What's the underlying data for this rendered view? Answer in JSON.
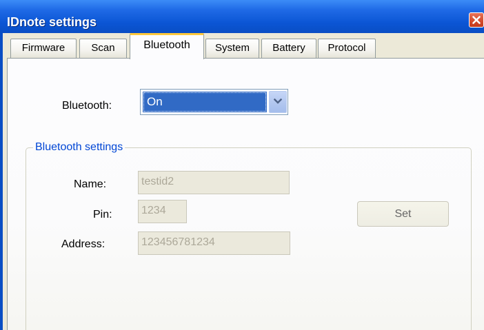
{
  "window": {
    "title": "IDnote settings"
  },
  "tabs": [
    {
      "label": "Firmware",
      "active": false
    },
    {
      "label": "Scan",
      "active": false
    },
    {
      "label": "Bluetooth",
      "active": true
    },
    {
      "label": "System",
      "active": false
    },
    {
      "label": "Battery",
      "active": false
    },
    {
      "label": "Protocol",
      "active": false
    }
  ],
  "bluetooth": {
    "label": "Bluetooth:",
    "selected_value": "On"
  },
  "settings_group": {
    "title": "Bluetooth settings",
    "name_label": "Name:",
    "name_value": "testid2",
    "pin_label": "Pin:",
    "pin_value": "1234",
    "address_label": "Address:",
    "address_value": "123456781234",
    "set_label": "Set"
  },
  "colors": {
    "titlebar": "#0b55d4",
    "selection": "#316ac5",
    "group_title": "#0046d5",
    "active_tab_highlight": "#ffc83c",
    "close_button": "#d4492a"
  },
  "icons": {
    "close": "close-icon",
    "dropdown": "chevron-down-icon"
  }
}
